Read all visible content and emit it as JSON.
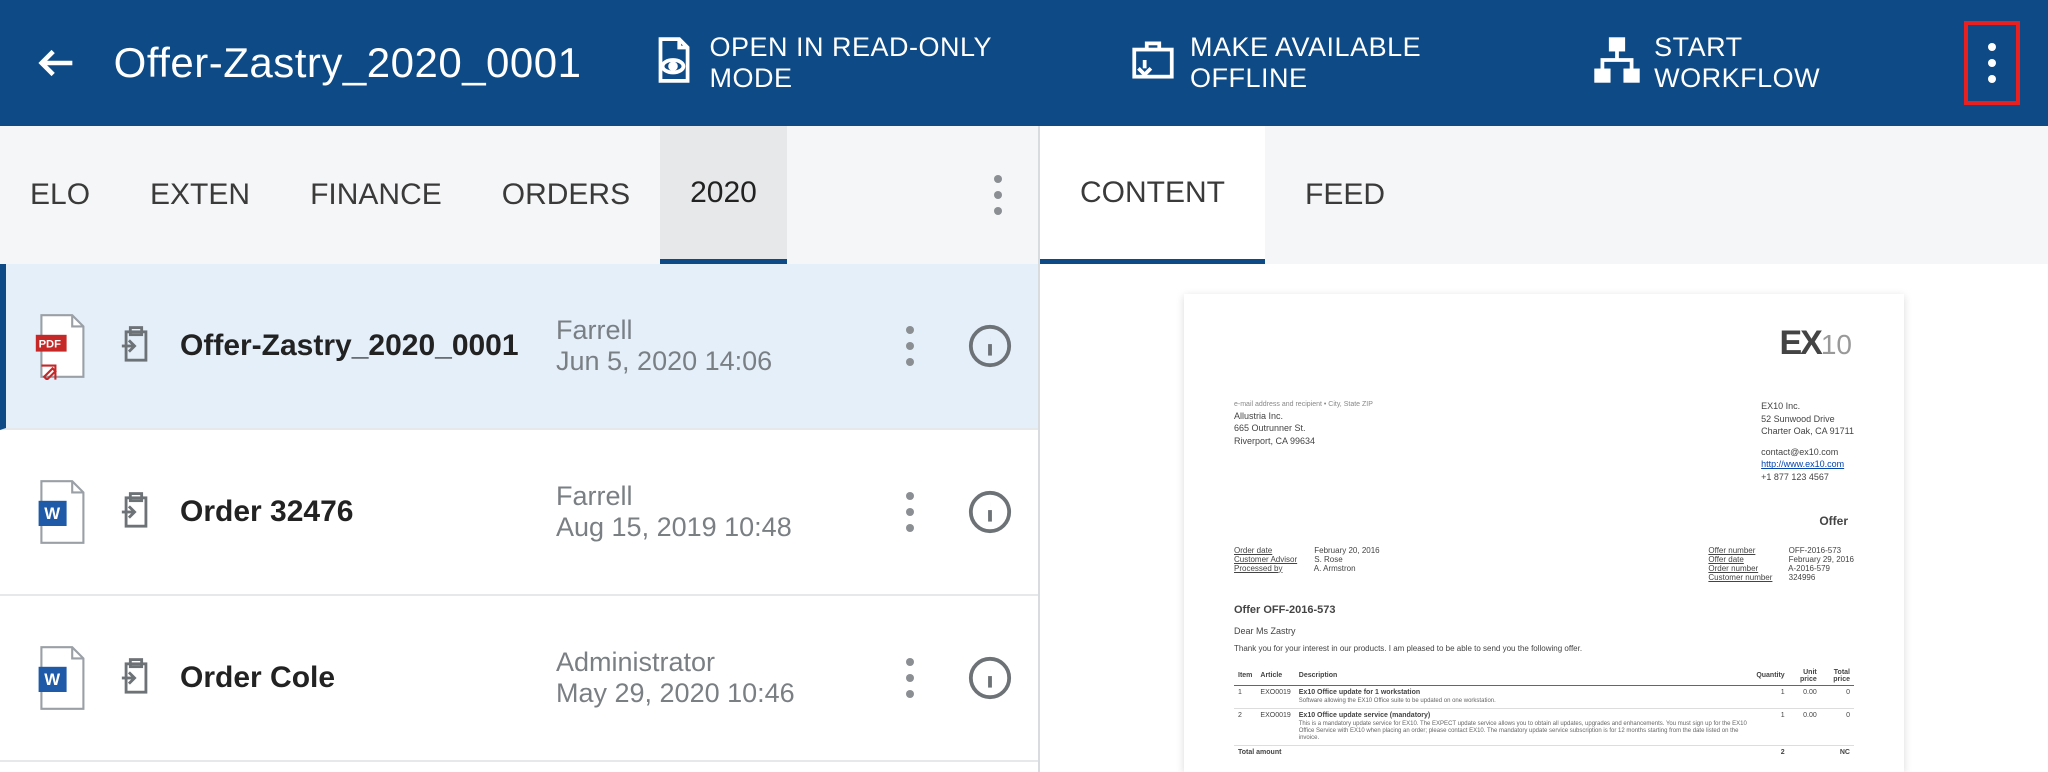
{
  "header": {
    "title": "Offer-Zastry_2020_0001",
    "actions": {
      "open_readonly": "OPEN IN READ-ONLY MODE",
      "make_offline": "MAKE AVAILABLE OFFLINE",
      "start_workflow": "START WORKFLOW"
    }
  },
  "breadcrumbs": [
    {
      "label": "ELO"
    },
    {
      "label": "EXTEN"
    },
    {
      "label": "FINANCE"
    },
    {
      "label": "ORDERS"
    },
    {
      "label": "2020",
      "active": true
    }
  ],
  "list": [
    {
      "type": "pdf",
      "title": "Offer-Zastry_2020_0001",
      "user": "Farrell",
      "date": "Jun 5, 2020 14:06",
      "selected": true
    },
    {
      "type": "word",
      "title": "Order 32476",
      "user": "Farrell",
      "date": "Aug 15, 2019 10:48",
      "selected": false
    },
    {
      "type": "word",
      "title": "Order Cole",
      "user": "Administrator",
      "date": "May 29, 2020 10:46",
      "selected": false
    }
  ],
  "right_tabs": {
    "content": "CONTENT",
    "feed": "FEED"
  },
  "preview": {
    "logo_main": "EX",
    "logo_sub": "10",
    "addr_left_name": "Allustria Inc.",
    "addr_left_street": "665 Outrunner St.",
    "addr_left_city": "Riverport, CA 99634",
    "addr_right_company": "EX10 Inc.",
    "addr_right_street": "52 Sunwood Drive",
    "addr_right_city": "Charter Oak, CA 91711",
    "addr_right_mail": "contact@ex10.com",
    "addr_right_web": "http://www.ex10.com",
    "addr_right_phone": "+1 877 123 4567",
    "offer_label": "Offer",
    "meta_left": [
      {
        "lab": "Order date",
        "val": "February 20, 2016"
      },
      {
        "lab": "Customer Advisor",
        "val": "S. Rose"
      },
      {
        "lab": "Processed by",
        "val": "A. Armstron"
      }
    ],
    "meta_right": [
      {
        "lab": "Offer number",
        "val": "OFF-2016-573"
      },
      {
        "lab": "Offer date",
        "val": "February 29, 2016"
      },
      {
        "lab": "Order number",
        "val": "A-2016-579"
      },
      {
        "lab": "Customer number",
        "val": "324996"
      }
    ],
    "offer_number_line": "Offer OFF-2016-573",
    "dear": "Dear Ms Zastry",
    "intro": "Thank you for your interest in our products. I am pleased to be able to send you the following offer.",
    "table_head": {
      "item": "Item",
      "article": "Article",
      "desc": "Description",
      "qty": "Quantity",
      "up": "Unit price",
      "tp": "Total price"
    },
    "rows": [
      {
        "item": "1",
        "article": "EXO0019",
        "desc": "Ex10 Office update for 1 workstation",
        "sub": "Software allowing the EX10 Office suite to be updated on one workstation.",
        "qty": "1",
        "up": "0.00",
        "tp": "0"
      },
      {
        "item": "2",
        "article": "EXO0019",
        "desc": "Ex10 Office update service (mandatory)",
        "sub": "This is a mandatory update service for EX10. The EXPECT update service allows you to obtain all updates, upgrades and enhancements. You must sign up for the EX10 Office Service with EX10 when placing an order; please contact EX10. The mandatory update service subscription is for 12 months starting from the date listed on the invoice.",
        "qty": "1",
        "up": "0.00",
        "tp": "0"
      }
    ],
    "total_label": "Total amount",
    "total_qty": "2",
    "total_val": "NC"
  }
}
